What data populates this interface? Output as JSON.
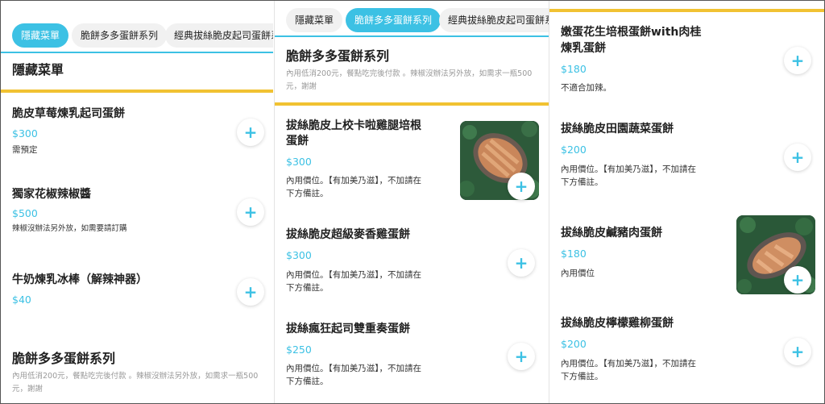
{
  "colors": {
    "accent": "#3cc1e4",
    "highlight": "#f1c232"
  },
  "panel1": {
    "tabs": [
      "隱藏菜單",
      "脆餅多多蛋餅系列",
      "經典拔絲脆皮起司蛋餅系列"
    ],
    "section_title": "隱藏菜單",
    "items": [
      {
        "name": "脆皮草莓煉乳起司蛋餅",
        "price": "$300",
        "note": "需預定"
      },
      {
        "name": "獨家花椒辣椒醬",
        "price": "$500",
        "note": "辣椒沒辦法另外放，如需要請訂購"
      },
      {
        "name": "牛奶煉乳冰棒（解辣神器）",
        "price": "$40",
        "note": ""
      }
    ],
    "section2_title": "脆餅多多蛋餅系列",
    "section2_desc_1": "內用低消200元，餐點吃完後付款 。辣椒沒辦法另外放，如需求一瓶500",
    "section2_desc_2": "元，謝謝"
  },
  "panel2": {
    "tabs": [
      "隱藏菜單",
      "脆餅多多蛋餅系列",
      "經典拔絲脆皮起司蛋餅系列"
    ],
    "section_title": "脆餅多多蛋餅系列",
    "section_desc_1": "內用低消200元，餐點吃完後付款 。辣椒沒辦法另外放，如需求一瓶500",
    "section_desc_2": "元，謝謝",
    "items": [
      {
        "name_1": "拔絲脆皮上校卡啦雞腿培根",
        "name_2": "蛋餅",
        "price": "$300",
        "note_1": "內用價位。【有加美乃滋】，不加請在",
        "note_2": "下方備註。"
      },
      {
        "name_1": "拔絲脆皮超級麥香雞蛋餅",
        "price": "$300",
        "note_1": "內用價位。【有加美乃滋】，不加請在",
        "note_2": "下方備註。"
      },
      {
        "name_1": "拔絲瘋狂起司雙重奏蛋餅",
        "price": "$250",
        "note_1": "內用價位。【有加美乃滋】，不加請在",
        "note_2": "下方備註。"
      }
    ]
  },
  "panel3": {
    "items": [
      {
        "name_1": "嫩蛋花生培根蛋餅with肉桂",
        "name_2": "煉乳蛋餅",
        "price": "$180",
        "note_1": "不適合加辣。"
      },
      {
        "name_1": "拔絲脆皮田園蔬菜蛋餅",
        "price": "$200",
        "note_1": "內用價位。【有加美乃滋】，不加請在",
        "note_2": "下方備註。"
      },
      {
        "name_1": "拔絲脆皮鹹豬肉蛋餅",
        "price": "$180",
        "note_1": "內用價位"
      },
      {
        "name_1": "拔絲脆皮檸檬雞柳蛋餅",
        "price": "$200",
        "note_1": "內用價位。【有加美乃滋】，不加請在",
        "note_2": "下方備註。"
      }
    ]
  },
  "icons": {
    "add": "plus-icon",
    "food": "food-photo"
  },
  "add_symbol": "+"
}
